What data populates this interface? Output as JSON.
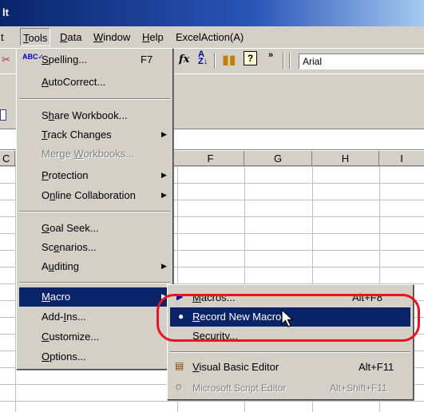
{
  "window": {
    "title_fragment": "lt"
  },
  "menubar": {
    "items": [
      {
        "label": "t"
      },
      {
        "label": "Tools",
        "accel": "T"
      },
      {
        "label": "Data",
        "accel": "D"
      },
      {
        "label": "Window",
        "accel": "W"
      },
      {
        "label": "Help",
        "accel": "H"
      },
      {
        "label": "ExcelAction(A)"
      }
    ]
  },
  "toolbar": {
    "font_name": "Arial",
    "icons": [
      "cut-icon",
      "fx-icon",
      "sort-ascending-icon",
      "chart-wizard-icon",
      "help-icon",
      "more-buttons-icon"
    ]
  },
  "columns": [
    "C",
    "F",
    "G",
    "H",
    "I"
  ],
  "tools_menu": {
    "items": [
      {
        "label": "Spelling...",
        "shortcut": "F7"
      },
      {
        "label": "AutoCorrect..."
      },
      {
        "label": "Share Workbook..."
      },
      {
        "label": "Track Changes"
      },
      {
        "label": "Merge Workbooks..."
      },
      {
        "label": "Protection"
      },
      {
        "label": "Online Collaboration"
      },
      {
        "label": "Goal Seek..."
      },
      {
        "label": "Scenarios..."
      },
      {
        "label": "Auditing"
      },
      {
        "label": "Macro"
      },
      {
        "label": "Add-Ins..."
      },
      {
        "label": "Customize..."
      },
      {
        "label": "Options..."
      }
    ]
  },
  "macro_menu": {
    "items": [
      {
        "label": "Macros...",
        "shortcut": "Alt+F8"
      },
      {
        "label": "Record New Macro..."
      },
      {
        "label": "Security..."
      },
      {
        "label": "Visual Basic Editor",
        "shortcut": "Alt+F11"
      },
      {
        "label": "Microsoft Script Editor",
        "shortcut": "Alt+Shift+F11"
      }
    ]
  },
  "colors": {
    "highlight": "#0a246a",
    "menu_bg": "#d4d0c8",
    "annotation": "#e8141e"
  }
}
